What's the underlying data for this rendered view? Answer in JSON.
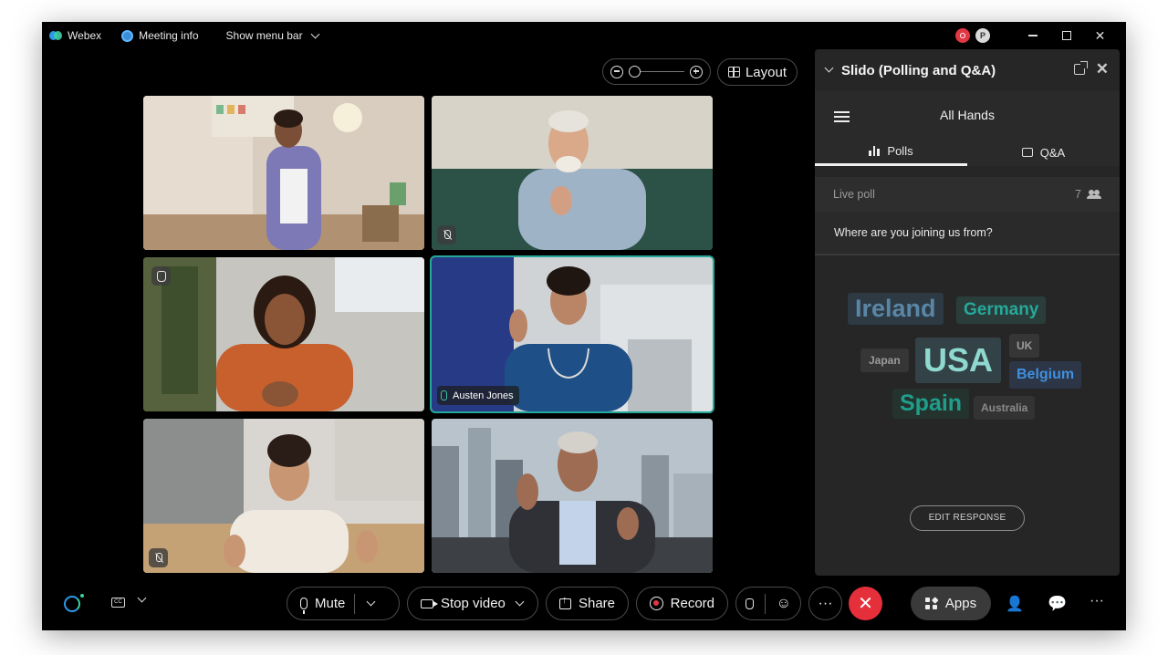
{
  "titlebar": {
    "app_name": "Webex",
    "meeting_info": "Meeting info",
    "show_menu_bar": "Show menu bar"
  },
  "controls": {
    "layout_label": "Layout"
  },
  "participants": [
    {
      "name": "",
      "muted": false
    },
    {
      "name": "",
      "muted": true
    },
    {
      "name": "",
      "hand_raised": true
    },
    {
      "name": "Austen Jones",
      "active_speaker": true
    },
    {
      "name": "",
      "muted": true
    },
    {
      "name": ""
    }
  ],
  "slido": {
    "title": "Slido (Polling and Q&A)",
    "event": "All Hands",
    "tabs": [
      {
        "label": "Polls",
        "active": true
      },
      {
        "label": "Q&A",
        "active": false
      }
    ],
    "live_poll_label": "Live poll",
    "participant_count": "7",
    "question": "Where are you joining us from?",
    "word_cloud": [
      {
        "word": "Ireland",
        "color": "#5a86a6"
      },
      {
        "word": "Germany",
        "color": "#25a99a"
      },
      {
        "word": "Japan",
        "color": "#8c8c8c"
      },
      {
        "word": "USA",
        "color": "#8fd8d0"
      },
      {
        "word": "UK",
        "color": "#8c8c8c"
      },
      {
        "word": "Belgium",
        "color": "#3f8fe0"
      },
      {
        "word": "Spain",
        "color": "#1f9e8a"
      },
      {
        "word": "Australia",
        "color": "#7c7c7c"
      }
    ],
    "edit_response_label": "EDIT RESPONSE"
  },
  "toolbar": {
    "mute_label": "Mute",
    "stop_video_label": "Stop video",
    "share_label": "Share",
    "record_label": "Record",
    "apps_label": "Apps",
    "more_label": "···"
  },
  "colors": {
    "accent_teal": "#25a89a",
    "end_call_red": "#e5303c",
    "record_red": "#e23744"
  }
}
